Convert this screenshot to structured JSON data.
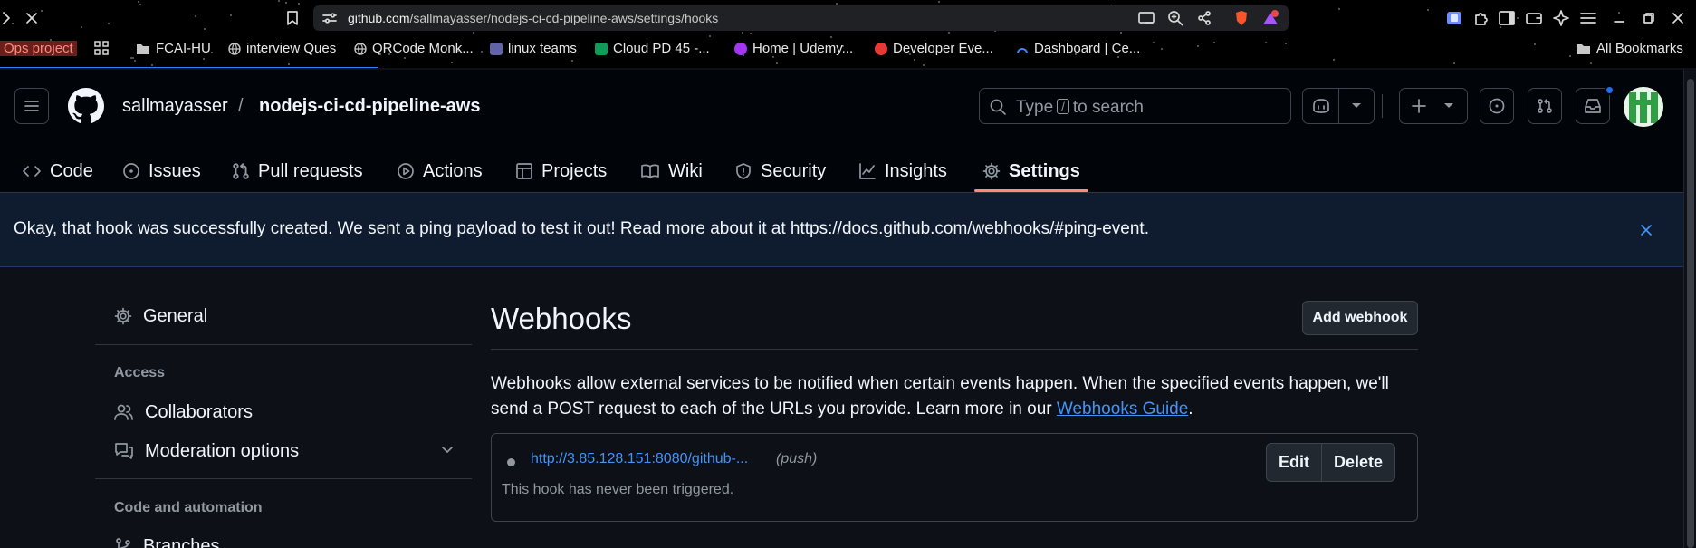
{
  "browser": {
    "url_host": "github.com",
    "url_path": "/sallmayasser/nodejs-ci-cd-pipeline-aws/settings/hooks",
    "bookmarks": [
      {
        "label": "Ops project",
        "color": "#c0392b"
      },
      {
        "label": "FCAI-HU",
        "color": "#9aa0a6"
      },
      {
        "label": "interview Ques",
        "color": "#9aa0a6"
      },
      {
        "label": "QRCode Monk...",
        "color": "#9aa0a6"
      },
      {
        "label": "linux teams",
        "color": "#6264a7"
      },
      {
        "label": "Cloud PD 45 -...",
        "color": "#0f9d58"
      },
      {
        "label": "Home | Udemy...",
        "color": "#a435f0"
      },
      {
        "label": "Developer Eve...",
        "color": "#e53935"
      },
      {
        "label": "Dashboard | Ce...",
        "color": "#4285f4"
      }
    ],
    "all_bookmarks": "All Bookmarks"
  },
  "header": {
    "owner": "sallmayasser",
    "separator": "/",
    "repo": "nodejs-ci-cd-pipeline-aws",
    "search_placeholder_pre": "Type",
    "search_key": "/",
    "search_placeholder_post": "to search"
  },
  "tabs": [
    {
      "label": "Code",
      "icon": "code-icon"
    },
    {
      "label": "Issues",
      "icon": "issue-opened-icon"
    },
    {
      "label": "Pull requests",
      "icon": "git-pull-request-icon"
    },
    {
      "label": "Actions",
      "icon": "play-icon"
    },
    {
      "label": "Projects",
      "icon": "table-icon"
    },
    {
      "label": "Wiki",
      "icon": "book-icon"
    },
    {
      "label": "Security",
      "icon": "shield-icon"
    },
    {
      "label": "Insights",
      "icon": "graph-icon"
    },
    {
      "label": "Settings",
      "icon": "gear-icon",
      "selected": true
    }
  ],
  "flash": {
    "message": "Okay, that hook was successfully created. We sent a ping payload to test it out! Read more about it at https://docs.github.com/webhooks/#ping-event."
  },
  "sidebar": {
    "general": "General",
    "access_heading": "Access",
    "collaborators": "Collaborators",
    "moderation": "Moderation options",
    "code_heading": "Code and automation",
    "branches": "Branches"
  },
  "main": {
    "title": "Webhooks",
    "add_button": "Add webhook",
    "description_1": "Webhooks allow external services to be notified when certain events happen. When the specified events happen, we'll send a POST request to each of the URLs you provide. Learn more in our ",
    "description_link": "Webhooks Guide",
    "description_2": ".",
    "hook": {
      "url": "http://3.85.128.151:8080/github-...",
      "events": "(push)",
      "status": "This hook has never been triggered.",
      "edit": "Edit",
      "delete": "Delete"
    }
  },
  "colors": {
    "accent": "#4493f8",
    "selected_tab_underline": "#fd8c73",
    "background": "#0d1117"
  }
}
